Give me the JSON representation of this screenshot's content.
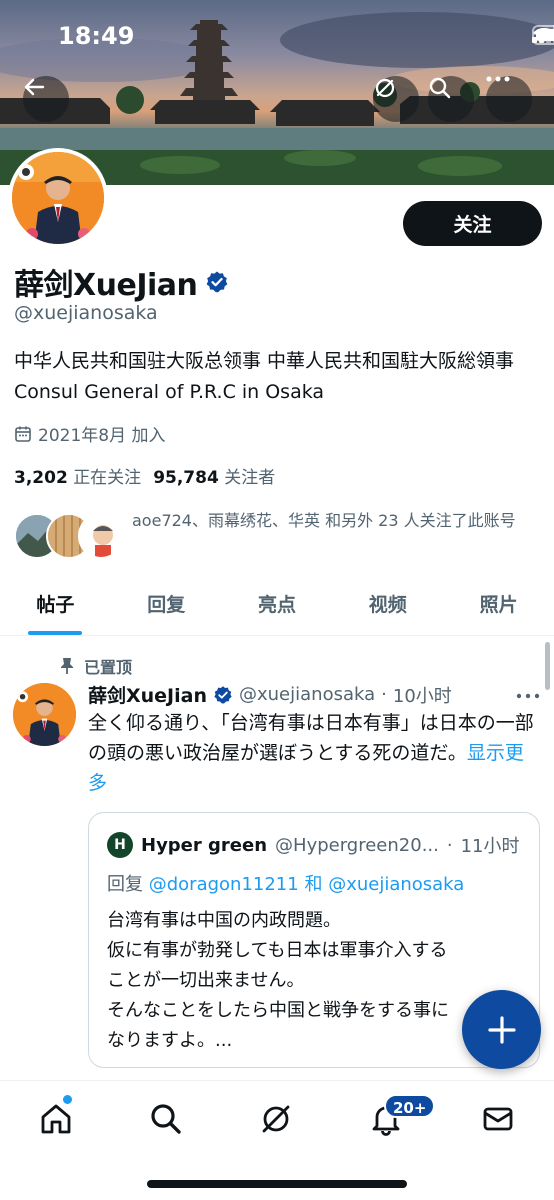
{
  "status_bar": {
    "time": "18:49"
  },
  "profile": {
    "display_name": "薛剑XueJian",
    "handle": "@xuejianosaka",
    "follow_label": "关注",
    "bio": "中华人民共和国驻大阪总领事 中華人民共和国駐大阪総領事 Consul General of P.R.C in Osaka",
    "joined": "2021年8月 加入",
    "following_count": "3,202",
    "following_label": "正在关注",
    "followers_count": "95,784",
    "followers_label": "关注者",
    "followed_by": "aoe724、雨幕绣花、华英 和另外 23 人关注了此账号"
  },
  "tabs": [
    {
      "label": "帖子",
      "active": true
    },
    {
      "label": "回复"
    },
    {
      "label": "亮点"
    },
    {
      "label": "视频"
    },
    {
      "label": "照片"
    }
  ],
  "post": {
    "pinned_label": "已置顶",
    "author_name": "薛剑XueJian",
    "author_handle": "@xuejianosaka",
    "separator": "·",
    "time": "10小时",
    "text": "全く仰る通り、「台湾有事は日本有事」は日本の一部の頭の悪い政治屋が選ぼうとする死の道だ。",
    "show_more": "显示更多",
    "quote": {
      "avatar_letter": "H",
      "name": "Hyper green",
      "handle": "@Hypergreen20...",
      "time": "11小时",
      "reply_prefix": "回复",
      "reply_mention1": "@doragon11211",
      "reply_and": "和",
      "reply_mention2": "@xuejianosaka",
      "text_lines": [
        "台湾有事は中国の内政問題。",
        "仮に有事が勃発しても日本は軍事介入する",
        "ことが一切出来ません。",
        "そんなことをしたら中国と戦争をする事に",
        "なりますよ。..."
      ]
    }
  },
  "bottom_nav": {
    "notifications_badge": "20+"
  },
  "colors": {
    "accent": "#1d9bf0",
    "fab": "#0d4aa0",
    "primary_text": "#0f1419",
    "secondary_text": "#536471"
  }
}
